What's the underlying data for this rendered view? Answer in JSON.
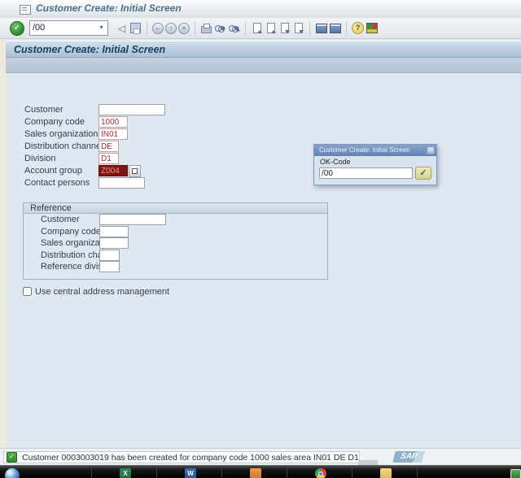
{
  "window": {
    "title": "Customer Create: Initial Screen"
  },
  "toolbar": {
    "command_value": "/00",
    "buttons": [
      "enter",
      "command-field",
      "back",
      "save",
      "system-back",
      "system-exit",
      "system-cancel",
      "print",
      "find",
      "find-next",
      "first-page",
      "previous-page",
      "next-page",
      "last-page",
      "new-session",
      "create-shortcut",
      "help",
      "customize-local-layout"
    ]
  },
  "screen": {
    "title": "Customer Create: Initial Screen"
  },
  "form": {
    "fields": [
      {
        "label": "Customer",
        "value": ""
      },
      {
        "label": "Company code",
        "value": "1000"
      },
      {
        "label": "Sales organization",
        "value": "IN01"
      },
      {
        "label": "Distribution channel",
        "value": "DE"
      },
      {
        "label": "Division",
        "value": "D1"
      },
      {
        "label": "Account group",
        "value": "Z004"
      },
      {
        "label": "Contact persons",
        "value": ""
      }
    ]
  },
  "reference": {
    "title": "Reference",
    "fields": [
      {
        "label": "Customer",
        "value": ""
      },
      {
        "label": "Company code",
        "value": ""
      },
      {
        "label": "Sales organization",
        "value": ""
      },
      {
        "label": "Distribution channel",
        "value": ""
      },
      {
        "label": "Reference division",
        "value": ""
      }
    ]
  },
  "options": {
    "central_address_label": "Use central address management",
    "checked": false
  },
  "popup": {
    "title": "Customer Create: Initial Screen",
    "ok_code_label": "OK-Code",
    "ok_code_value": "/00",
    "close_glyph": "×",
    "confirm_glyph": "✓"
  },
  "statusbar": {
    "status_icon": "success-check",
    "message": "Customer 0003003019 has been created for company code 1000 sales area IN01 DE D1",
    "logo_text": "SAP"
  },
  "taskbar": {
    "apps": [
      "windows-start",
      "excel",
      "word",
      "documents",
      "chrome",
      "folder"
    ],
    "tray": "green-indicator"
  },
  "colors": {
    "accent_red": "#a82f2f",
    "selected_field_bg": "#7e1515",
    "success_green": "#2e8b2e",
    "popup_title_from": "#87a3c9",
    "popup_title_to": "#5d83b4"
  }
}
